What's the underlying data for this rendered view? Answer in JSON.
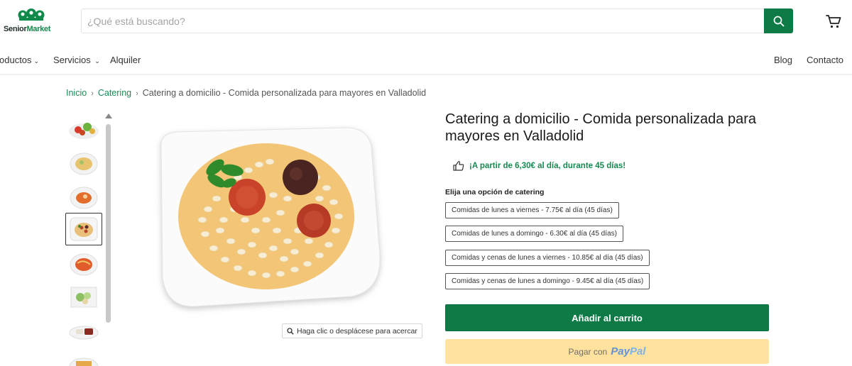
{
  "header": {
    "brand_part1": "Senior",
    "brand_part2": "Market",
    "search_placeholder": "¿Qué está buscando?",
    "icons": [
      "search-icon",
      "cart-icon",
      "logo-people-icon"
    ]
  },
  "nav": {
    "items": [
      {
        "label": "oductos",
        "has_caret": true
      },
      {
        "label": "Servicios",
        "has_caret": true
      },
      {
        "label": "Alquiler",
        "has_caret": false
      },
      {
        "label": "Blog",
        "has_caret": false
      },
      {
        "label": "Contacto",
        "has_caret": false
      }
    ]
  },
  "breadcrumb": {
    "items": [
      "Inicio",
      "Catering",
      "Catering a domicilio - Comida personalizada para mayores en Valladolid"
    ]
  },
  "gallery": {
    "thumbnail_count": 8,
    "active_index": 3,
    "zoom_hint": "Haga clic o desplácese para acercar"
  },
  "product": {
    "title": "Catering a domicilio - Comida personalizada para mayores en Valladolid",
    "promo": "¡A partir de 6,30€ al día, durante 45 días!",
    "option_label": "Elija una opción de catering",
    "options": [
      "Comidas de lunes a viernes - 7.75€ al día (45 días)",
      "Comidas de lunes a domingo - 6.30€ al día (45 días)",
      "Comidas y cenas de lunes a viernes - 10.85€ al día (45 días)",
      "Comidas y cenas de lunes a domingo - 9.45€ al día (45 días)"
    ],
    "add_to_cart": "Añadir al carrito",
    "paypal_prefix": "Pagar con",
    "paypal_logo_a": "Pay",
    "paypal_logo_b": "Pal"
  },
  "colors": {
    "brand_green": "#0e7a45",
    "link_green": "#1d8a57",
    "paypal_yellow": "#ffdd8c"
  }
}
